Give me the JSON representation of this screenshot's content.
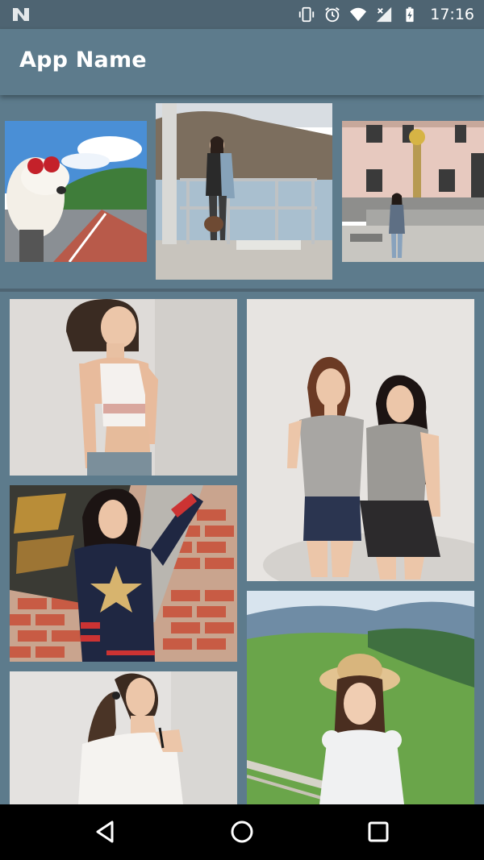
{
  "status_bar": {
    "time": "17:16",
    "icons": [
      "android-n-icon",
      "vibrate-icon",
      "alarm-icon",
      "wifi-icon",
      "no-signal-icon",
      "battery-charging-icon"
    ]
  },
  "app_bar": {
    "title": "App Name"
  },
  "carousel": {
    "items": [
      {
        "icon": "photo-dog-goggles-road"
      },
      {
        "icon": "photo-girl-railing-lake"
      },
      {
        "icon": "photo-girl-fountain-building"
      }
    ]
  },
  "grid": {
    "left_column": [
      {
        "icon": "photo-girl-white-top"
      },
      {
        "icon": "photo-girl-star-sweater-brick-wall"
      },
      {
        "icon": "photo-girl-ponytail-offshoulder"
      }
    ],
    "right_column": [
      {
        "icon": "photo-two-girls-grey-tops"
      },
      {
        "icon": "photo-girl-straw-hat-meadow"
      }
    ]
  },
  "nav_bar": {
    "buttons": [
      "back-icon",
      "home-icon",
      "recents-icon"
    ]
  },
  "colors": {
    "toolbar": "#5d7b8c",
    "status_bar": "#4e6472",
    "nav_bar": "#000000"
  }
}
